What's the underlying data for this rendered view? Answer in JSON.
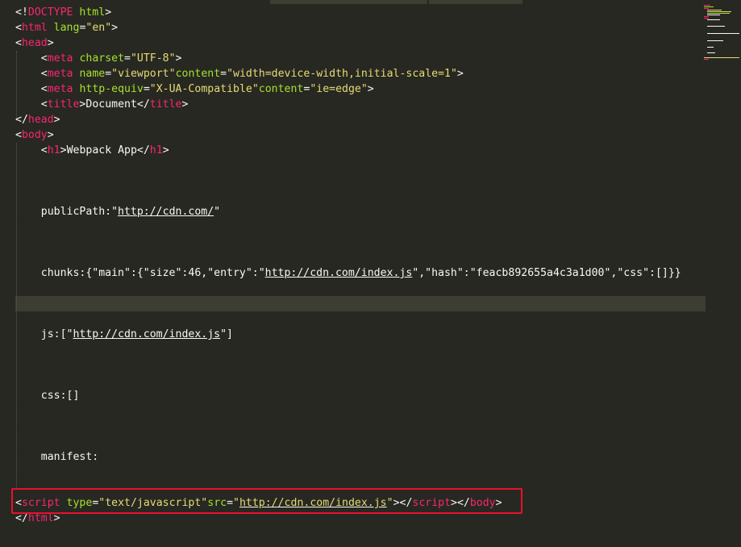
{
  "code": {
    "doctype": "<!DOCTYPE",
    "doctype_html": "html",
    "l1_open": "<",
    "html_tag": "html",
    "lang_attr": "lang",
    "lang_val": "\"en\"",
    "close_bracket": ">",
    "head_tag": "head",
    "meta_tag": "meta",
    "charset_attr": "charset",
    "charset_val": "\"UTF-8\"",
    "name_attr": "name",
    "name_val": "\"viewport\"",
    "content_attr": "content",
    "content_val": "\"width=device-width,initial-scale=1\"",
    "http_equiv_attr": "http-equiv",
    "http_equiv_val": "\"X-UA-Compatible\"",
    "content2_val": "\"ie=edge\"",
    "title_tag": "title",
    "title_text": "Document",
    "body_tag": "body",
    "h1_tag": "h1",
    "h1_text": "Webpack App",
    "public_path_label": "publicPath:\"",
    "public_path_url": "http://cdn.com/",
    "public_path_end": "\"",
    "chunks_prefix": "chunks:{\"main\":{\"size\":46,\"entry\":\"",
    "chunks_url": "http://cdn.com/index.js",
    "chunks_suffix": "\",\"hash\":\"feacb892655a4c3a1d00\",\"css\":[]}}",
    "js_prefix": "js:[\"",
    "js_url": "http://cdn.com/index.js",
    "js_suffix": "\"]",
    "css_line": "css:[]",
    "manifest_line": "manifest:",
    "script_tag": "script",
    "type_attr": "type",
    "type_val": "\"text/javascript\"",
    "src_attr": "src",
    "src_q1": "\"",
    "src_url": "http://cdn.com/index.js",
    "src_q2": "\""
  },
  "colors": {
    "background": "#272822",
    "tag": "#f92672",
    "attribute": "#a6e22e",
    "string": "#e6db74",
    "text": "#f8f8f2",
    "highlight_box": "#e8112d"
  }
}
